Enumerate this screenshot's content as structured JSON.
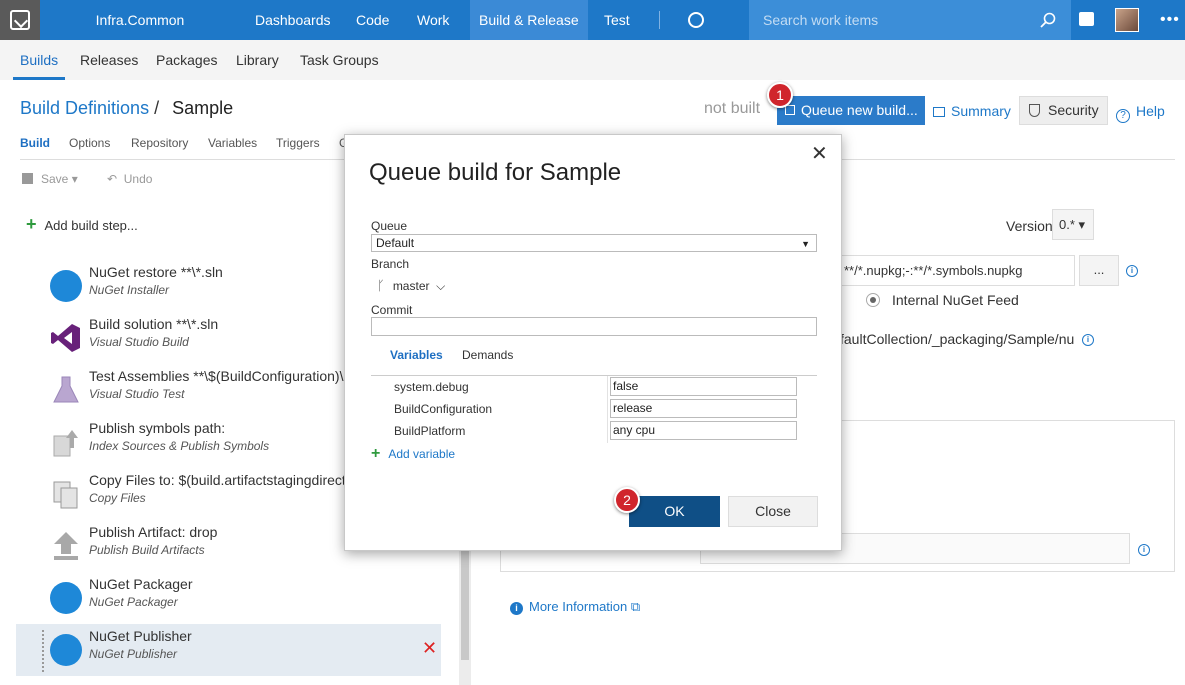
{
  "topbar": {
    "project": "Infra.Common",
    "nav": [
      "Dashboards",
      "Code",
      "Work",
      "Build & Release",
      "Test"
    ],
    "active_nav": "Build & Release",
    "search_placeholder": "Search work items"
  },
  "subnav": {
    "tabs": [
      "Builds",
      "Releases",
      "Packages",
      "Library",
      "Task Groups"
    ],
    "active": "Builds"
  },
  "header": {
    "breadcrumb_link": "Build Definitions",
    "separator": "/",
    "definition_name": "Sample",
    "status": "not built",
    "queue_button": "Queue new build...",
    "summary": "Summary",
    "security": "Security",
    "help": "Help"
  },
  "definition_tabs": [
    "Build",
    "Options",
    "Repository",
    "Variables",
    "Triggers",
    "G"
  ],
  "toolbar": {
    "save": "Save",
    "undo": "Undo"
  },
  "steps": {
    "add_label": "Add build step...",
    "items": [
      {
        "title": "NuGet restore **\\*.sln",
        "subtitle": "NuGet Installer",
        "icon": "nuget-icon"
      },
      {
        "title": "Build solution **\\*.sln",
        "subtitle": "Visual Studio Build",
        "icon": "visual-studio-icon"
      },
      {
        "title": "Test Assemblies **\\$(BuildConfiguration)\\",
        "subtitle": "Visual Studio Test",
        "icon": "flask-icon"
      },
      {
        "title": "Publish symbols path:",
        "subtitle": "Index Sources & Publish Symbols",
        "icon": "publish-symbols-icon"
      },
      {
        "title": "Copy Files to: $(build.artifactstagingdirect",
        "subtitle": "Copy Files",
        "icon": "copy-files-icon"
      },
      {
        "title": "Publish Artifact: drop",
        "subtitle": "Publish Build Artifacts",
        "icon": "upload-icon"
      },
      {
        "title": "NuGet Packager",
        "subtitle": "NuGet Packager",
        "icon": "nuget-packager-icon"
      },
      {
        "title": "NuGet Publisher",
        "subtitle": "NuGet Publisher",
        "icon": "nuget-publisher-icon"
      }
    ]
  },
  "right_panel": {
    "version_label": "Version",
    "version_value": "0.*",
    "pattern_value": "**/*.nupkg;-:**/*.symbols.nupkg",
    "pattern_button": "...",
    "feed_option": "Internal NuGet Feed",
    "feed_url": "faultCollection/_packaging/Sample/nu",
    "more_info": "More Information"
  },
  "dialog": {
    "title": "Queue build for Sample",
    "queue_label": "Queue",
    "queue_value": "Default",
    "branch_label": "Branch",
    "branch_value": "master",
    "commit_label": "Commit",
    "commit_value": "",
    "tabs": [
      "Variables",
      "Demands"
    ],
    "variables": [
      {
        "name": "system.debug",
        "value": "false"
      },
      {
        "name": "BuildConfiguration",
        "value": "release"
      },
      {
        "name": "BuildPlatform",
        "value": "any cpu"
      }
    ],
    "add_variable": "Add variable",
    "ok": "OK",
    "close": "Close"
  },
  "callouts": [
    "1",
    "2"
  ],
  "colors": {
    "topbar": "#1e78c8",
    "primary_button": "#0f4f86",
    "callout": "#d0252c",
    "add_green": "#2f9a3e",
    "delete_red": "#dd2222"
  }
}
